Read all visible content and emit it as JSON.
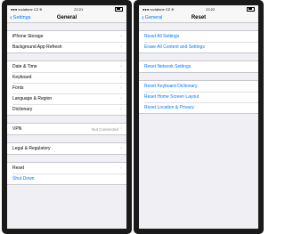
{
  "left": {
    "status": {
      "carrier": "vodafone CZ",
      "time": "22:21"
    },
    "nav": {
      "back": "Settings",
      "title": "General"
    },
    "groups": [
      [
        {
          "label": "iPhone Storage"
        },
        {
          "label": "Background App Refresh"
        }
      ],
      [
        {
          "label": "Date & Time"
        },
        {
          "label": "Keyboard"
        },
        {
          "label": "Fonts"
        },
        {
          "label": "Language & Region"
        },
        {
          "label": "Dictionary"
        }
      ],
      [
        {
          "label": "VPN",
          "detail": "Not Connected"
        }
      ],
      [
        {
          "label": "Legal & Regulatory"
        }
      ],
      [
        {
          "label": "Reset"
        },
        {
          "label": "Shut Down"
        }
      ]
    ]
  },
  "right": {
    "status": {
      "carrier": "vodafone CZ",
      "time": "22:22"
    },
    "nav": {
      "back": "General",
      "title": "Reset"
    },
    "groups": [
      [
        {
          "label": "Reset All Settings"
        },
        {
          "label": "Erase All Content and Settings"
        }
      ],
      [
        {
          "label": "Reset Network Settings"
        }
      ],
      [
        {
          "label": "Reset Keyboard Dictionary"
        },
        {
          "label": "Reset Home Screen Layout"
        },
        {
          "label": "Reset Location & Privacy"
        }
      ]
    ]
  },
  "icons": {
    "back": "chevron-left-icon",
    "disclosure": "chevron-right-icon",
    "wifi": "wifi-icon",
    "battery": "battery-icon"
  },
  "colors": {
    "accent": "#007aff",
    "background": "#efeff4"
  }
}
